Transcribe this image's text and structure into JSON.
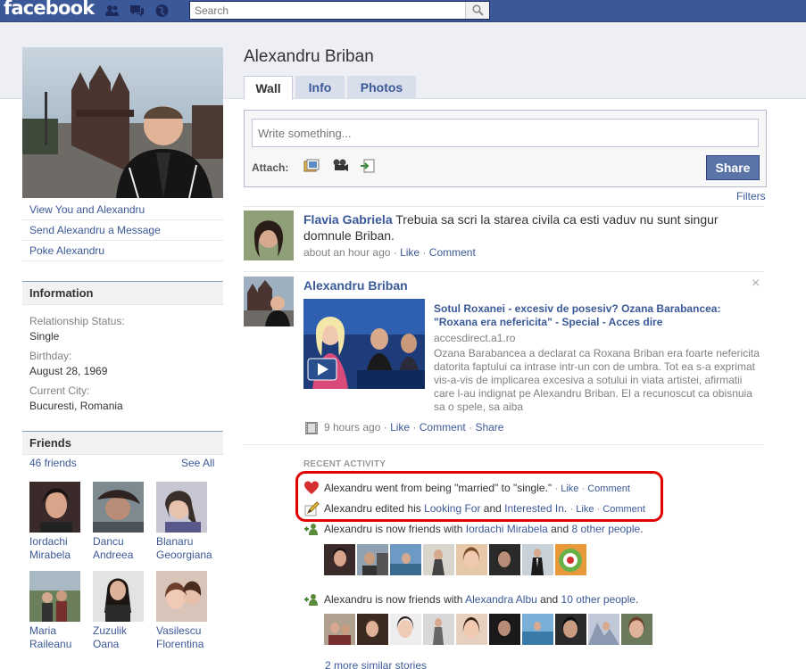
{
  "header": {
    "logo": "facebook",
    "search_placeholder": "Search"
  },
  "profile": {
    "name": "Alexandru Briban",
    "links": [
      "View You and Alexandru",
      "Send Alexandru a Message",
      "Poke Alexandru"
    ]
  },
  "tabs": [
    {
      "label": "Wall",
      "active": true
    },
    {
      "label": "Info",
      "active": false
    },
    {
      "label": "Photos",
      "active": false
    }
  ],
  "information": {
    "title": "Information",
    "fields": [
      {
        "label": "Relationship Status:",
        "value": "Single"
      },
      {
        "label": "Birthday:",
        "value": "August 28, 1969"
      },
      {
        "label": "Current City:",
        "value": "Bucuresti, Romania"
      }
    ]
  },
  "friends": {
    "title": "Friends",
    "count": "46 friends",
    "see_all": "See All",
    "list": [
      {
        "first": "Iordachi",
        "last": "Mirabela"
      },
      {
        "first": "Dancu",
        "last": "Andreea"
      },
      {
        "first": "Blanaru",
        "last": "Geoorgiana"
      },
      {
        "first": "Maria",
        "last": "Raileanu"
      },
      {
        "first": "Zuzulik",
        "last": "Oana"
      },
      {
        "first": "Vasilescu",
        "last": "Florentina"
      }
    ]
  },
  "composer": {
    "placeholder": "Write something...",
    "attach_label": "Attach:",
    "share_label": "Share"
  },
  "filters_label": "Filters",
  "stories": {
    "post1": {
      "actor": "Flavia Gabriela",
      "text": "Trebuia sa scri la starea civila ca esti vaduv nu sunt singur domnule Briban.",
      "time": "about an hour ago",
      "like": "Like",
      "comment": "Comment"
    },
    "post2": {
      "actor": "Alexandru Briban",
      "close": "×",
      "link_title": "Sotul Roxanei - excesiv de posesiv? Ozana Barabancea: \"Roxana era nefericita\" - Special - Acces dire",
      "link_domain": "accesdirect.a1.ro",
      "link_desc": "Ozana Barabancea a declarat ca Roxana Briban era foarte nefericita datorita faptului ca intrase intr-un con de umbra. Tot ea s-a exprimat vis-a-vis de implicarea excesiva a sotului in viata artistei, afirmatii care l-au indignat pe Alexandru Briban. El a recunoscut ca obisnuia sa o spele, sa aiba",
      "time": "9 hours ago",
      "like": "Like",
      "comment": "Comment",
      "share": "Share"
    }
  },
  "recent_activity": {
    "header": "RECENT ACTIVITY",
    "item1": {
      "text": "Alexandru went from being \"married\" to \"single.\"",
      "like": "Like",
      "comment": "Comment"
    },
    "item2": {
      "prefix": "Alexandru edited his ",
      "link1": "Looking For",
      "mid": " and ",
      "link2": "Interested In",
      "suffix": ".",
      "like": "Like",
      "comment": "Comment"
    },
    "item3": {
      "prefix": "Alexandru is now friends with ",
      "friend": "Iordachi Mirabela",
      "mid": " and ",
      "others": "8 other people",
      "suffix": "."
    },
    "item4": {
      "prefix": "Alexandru is now friends with ",
      "friend": "Alexandra Albu",
      "mid": " and ",
      "others": "10 other people",
      "suffix": "."
    },
    "more": "2 more similar stories"
  },
  "colors": {
    "brand": "#3b5998",
    "highlight": "#e10000"
  }
}
